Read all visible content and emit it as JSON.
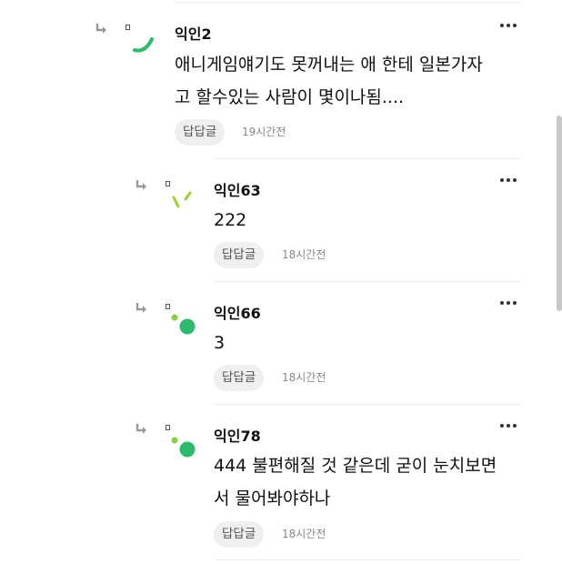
{
  "comments": [
    {
      "author": "익인2",
      "lines": [
        "애니게임얘기도 못꺼내는 애 한테 일본가자",
        "고 할수있는 사람이 몇이나됨...."
      ],
      "reply_label": "답답글",
      "time": "19시간전"
    },
    {
      "author": "익인63",
      "lines": [
        "222"
      ],
      "reply_label": "답답글",
      "time": "18시간전"
    },
    {
      "author": "익인66",
      "lines": [
        "3"
      ],
      "reply_label": "답답글",
      "time": "18시간전"
    },
    {
      "author": "익인78",
      "lines": [
        "444 불편해질 것 같은데 굳이 눈치보면",
        "서 물어봐야하나"
      ],
      "reply_label": "답답글",
      "time": "18시간전"
    }
  ],
  "icons": {
    "reply_arrow": "reply-arrow-icon",
    "more": "more-options-icon",
    "image_placeholder": "image-placeholder-icon"
  },
  "colors": {
    "avatar_green": "#2bbb6b",
    "avatar_lime": "#9bd330",
    "avatar_light_green": "#86d23a",
    "reply_btn_bg": "#efefef",
    "time_text": "#888888"
  }
}
